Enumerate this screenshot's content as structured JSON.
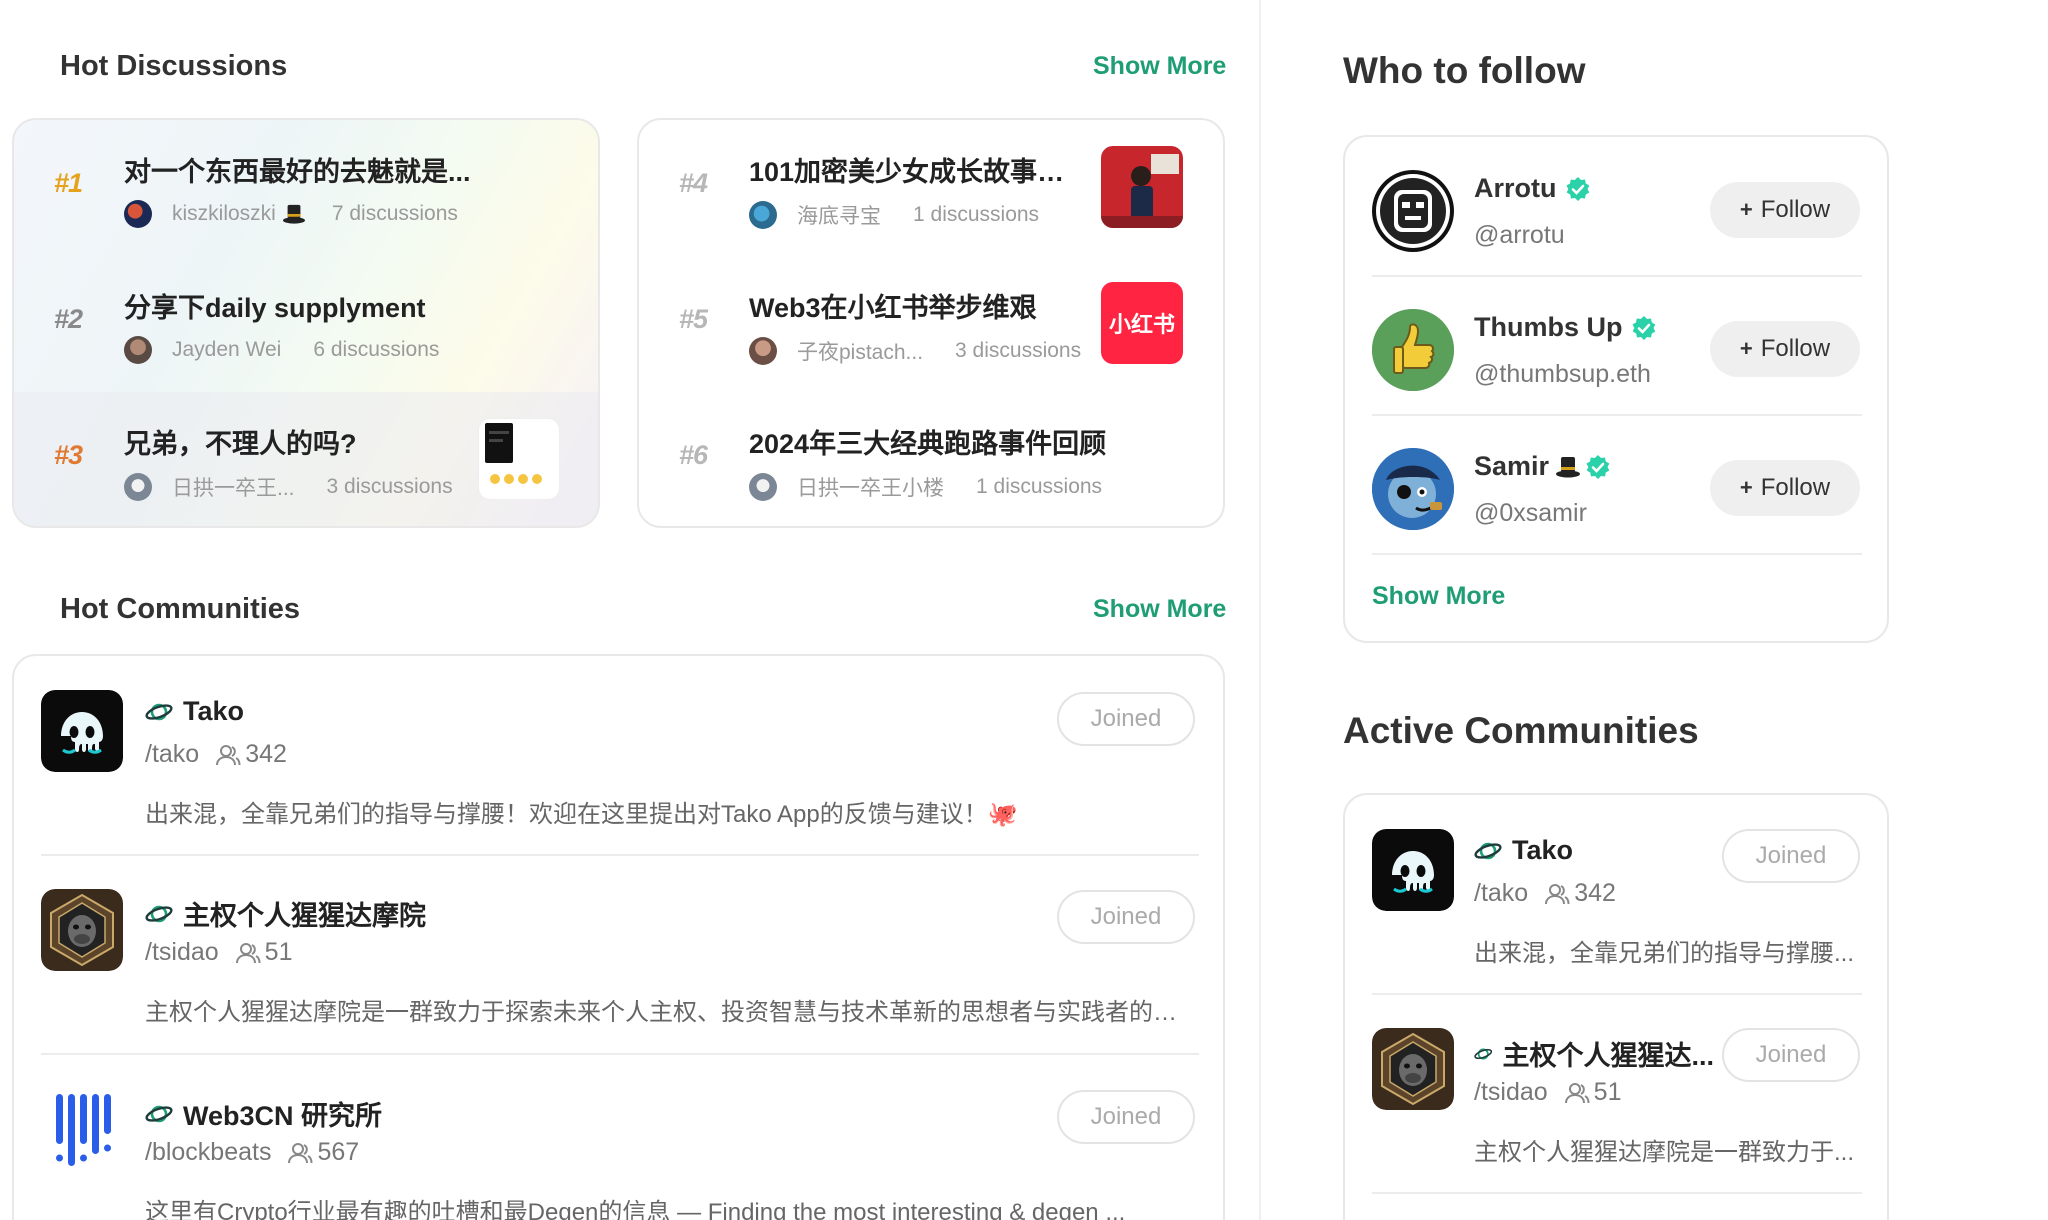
{
  "hot_discussions": {
    "title": "Hot Discussions",
    "show_more": "Show More",
    "items": [
      {
        "rank": "#1",
        "title": "对一个东西最好的去魅就是...",
        "author": "kiszkiloszki",
        "count": "7 discussions"
      },
      {
        "rank": "#2",
        "title": "分享下daily supplyment",
        "author": "Jayden Wei",
        "count": "6 discussions"
      },
      {
        "rank": "#3",
        "title": "兄弟，不理人的吗?",
        "author": "日拱一卒王...",
        "count": "3 discussions"
      },
      {
        "rank": "#4",
        "title": "101加密美少女成长故事会（...",
        "author": "海底寻宝",
        "count": "1 discussions"
      },
      {
        "rank": "#5",
        "title": "Web3在小红书举步维艰",
        "author": "子夜pistach...",
        "count": "3 discussions",
        "thumb_text": "小红书"
      },
      {
        "rank": "#6",
        "title": "2024年三大经典跑路事件回顾",
        "author": "日拱一卒王小楼",
        "count": "1 discussions"
      }
    ]
  },
  "hot_communities": {
    "title": "Hot Communities",
    "show_more": "Show More",
    "items": [
      {
        "name": "Tako",
        "path": "/tako",
        "members": "342",
        "desc": "出来混，全靠兄弟们的指导与撑腰！欢迎在这里提出对Tako App的反馈与建议！🐙",
        "button": "Joined"
      },
      {
        "name": "主权个人猩猩达摩院",
        "path": "/tsidao",
        "members": "51",
        "desc": "主权个人猩猩达摩院是一群致力于探索未来个人主权、投资智慧与技术革新的思想者与实践者的集...",
        "button": "Joined"
      },
      {
        "name": "Web3CN 研究所",
        "path": "/blockbeats",
        "members": "567",
        "desc": "这里有Crypto行业最有趣的吐槽和最Degen的信息 — Finding the most interesting & degen ...",
        "button": "Joined"
      }
    ]
  },
  "who_to_follow": {
    "title": "Who to follow",
    "show_more": "Show More",
    "follow_label": "Follow",
    "users": [
      {
        "name": "Arrotu",
        "handle": "@arrotu"
      },
      {
        "name": "Thumbs Up",
        "handle": "@thumbsup.eth"
      },
      {
        "name": "Samir",
        "handle": "@0xsamir"
      }
    ]
  },
  "active_communities": {
    "title": "Active Communities",
    "items": [
      {
        "name": "Tako",
        "path": "/tako",
        "members": "342",
        "desc": "出来混，全靠兄弟们的指导与撑腰...",
        "button": "Joined"
      },
      {
        "name": "主权个人猩猩达...",
        "path": "/tsidao",
        "members": "51",
        "desc": "主权个人猩猩达摩院是一群致力于...",
        "button": "Joined"
      }
    ]
  },
  "colors": {
    "accent": "#1f9d74",
    "verified": "#2bd1a8",
    "xhs_red": "#ff2442"
  }
}
